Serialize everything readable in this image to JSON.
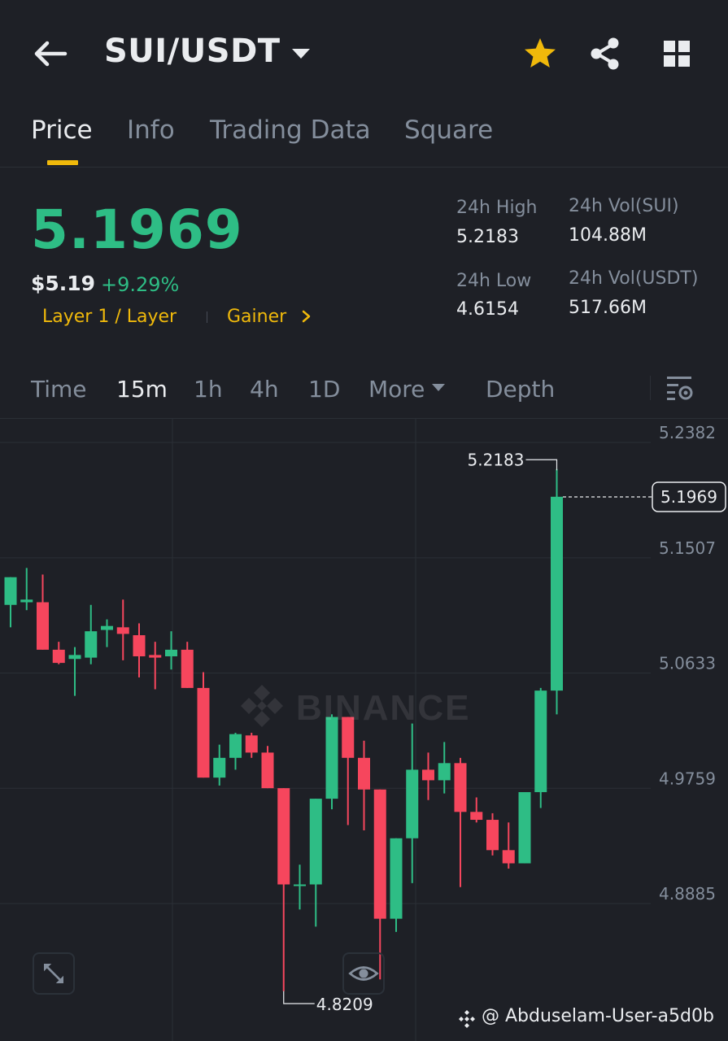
{
  "header": {
    "pair": "SUI/USDT",
    "icons": {
      "back": "arrow-left-icon",
      "caret": "caret-down-icon",
      "favorite": "star-icon",
      "share": "share-icon",
      "apps": "grid-icon"
    },
    "star_color": "#f0b90b"
  },
  "tabs": [
    {
      "label": "Price",
      "active": true
    },
    {
      "label": "Info",
      "active": false
    },
    {
      "label": "Trading Data",
      "active": false
    },
    {
      "label": "Square",
      "active": false
    }
  ],
  "price": {
    "last": "5.1969",
    "fiat": "$5.19",
    "change": "+9.29%",
    "tag_layer": "Layer 1 / Layer",
    "tag_gainer": "Gainer",
    "color_up": "#2ebd85",
    "color_down": "#f6465d",
    "accent": "#f0b90b"
  },
  "stats": {
    "high_label": "24h High",
    "high": "5.2183",
    "low_label": "24h Low",
    "low": "4.6154",
    "vol_base_label": "24h Vol(SUI)",
    "vol_base": "104.88M",
    "vol_quote_label": "24h Vol(USDT)",
    "vol_quote": "517.66M"
  },
  "timeframes": [
    {
      "label": "Time",
      "active": false
    },
    {
      "label": "15m",
      "active": true
    },
    {
      "label": "1h",
      "active": false
    },
    {
      "label": "4h",
      "active": false
    },
    {
      "label": "1D",
      "active": false
    },
    {
      "label": "More",
      "active": false
    },
    {
      "label": "Depth",
      "active": false
    }
  ],
  "chart_data": {
    "type": "candlestick",
    "interval": "15m",
    "y_ticks": [
      "5.2382",
      "5.1507",
      "5.0633",
      "4.9759",
      "4.8885"
    ],
    "ylim": [
      4.8011,
      5.2382
    ],
    "last_price": 5.1969,
    "last_price_label": "5.1969",
    "max_label": "5.2183",
    "min_label": "4.8209",
    "max_value": 5.2183,
    "min_value": 4.8209,
    "watermark": "BINANCE",
    "candles": [
      {
        "o": 5.115,
        "h": 5.126,
        "l": 5.098,
        "c": 5.136
      },
      {
        "o": 5.117,
        "h": 5.143,
        "l": 5.111,
        "c": 5.119
      },
      {
        "o": 5.117,
        "h": 5.138,
        "l": 5.085,
        "c": 5.081
      },
      {
        "o": 5.081,
        "h": 5.087,
        "l": 5.07,
        "c": 5.071
      },
      {
        "o": 5.074,
        "h": 5.083,
        "l": 5.046,
        "c": 5.077
      },
      {
        "o": 5.075,
        "h": 5.115,
        "l": 5.07,
        "c": 5.095
      },
      {
        "o": 5.096,
        "h": 5.104,
        "l": 5.083,
        "c": 5.099
      },
      {
        "o": 5.098,
        "h": 5.119,
        "l": 5.073,
        "c": 5.093
      },
      {
        "o": 5.092,
        "h": 5.101,
        "l": 5.06,
        "c": 5.076
      },
      {
        "o": 5.077,
        "h": 5.087,
        "l": 5.051,
        "c": 5.075
      },
      {
        "o": 5.076,
        "h": 5.095,
        "l": 5.066,
        "c": 5.081
      },
      {
        "o": 5.081,
        "h": 5.087,
        "l": 5.061,
        "c": 5.052
      },
      {
        "o": 5.052,
        "h": 5.064,
        "l": 4.984,
        "c": 4.984
      },
      {
        "o": 4.984,
        "h": 5.009,
        "l": 4.978,
        "c": 4.999
      },
      {
        "o": 4.999,
        "h": 5.018,
        "l": 4.99,
        "c": 5.017
      },
      {
        "o": 5.016,
        "h": 5.018,
        "l": 4.999,
        "c": 5.003
      },
      {
        "o": 5.003,
        "h": 5.008,
        "l": 4.977,
        "c": 4.976
      },
      {
        "o": 4.976,
        "h": 4.976,
        "l": 4.822,
        "c": 4.903
      },
      {
        "o": 4.903,
        "h": 4.918,
        "l": 4.884,
        "c": 4.903
      },
      {
        "o": 4.903,
        "h": 4.959,
        "l": 4.871,
        "c": 4.968
      },
      {
        "o": 4.968,
        "h": 5.032,
        "l": 4.96,
        "c": 5.03
      },
      {
        "o": 5.03,
        "h": 5.03,
        "l": 4.948,
        "c": 4.999
      },
      {
        "o": 4.999,
        "h": 5.012,
        "l": 4.944,
        "c": 4.975
      },
      {
        "o": 4.975,
        "h": 4.974,
        "l": 4.831,
        "c": 4.877
      },
      {
        "o": 4.877,
        "h": 4.927,
        "l": 4.867,
        "c": 4.938
      },
      {
        "o": 4.938,
        "h": 5.025,
        "l": 4.904,
        "c": 4.99
      },
      {
        "o": 4.99,
        "h": 5.003,
        "l": 4.967,
        "c": 4.982
      },
      {
        "o": 4.982,
        "h": 5.011,
        "l": 4.972,
        "c": 4.995
      },
      {
        "o": 4.995,
        "h": 4.999,
        "l": 4.901,
        "c": 4.958
      },
      {
        "o": 4.958,
        "h": 4.969,
        "l": 4.95,
        "c": 4.952
      },
      {
        "o": 4.952,
        "h": 4.957,
        "l": 4.925,
        "c": 4.929
      },
      {
        "o": 4.929,
        "h": 4.95,
        "l": 4.915,
        "c": 4.919
      },
      {
        "o": 4.919,
        "h": 4.971,
        "l": 4.92,
        "c": 4.973
      },
      {
        "o": 4.973,
        "h": 5.052,
        "l": 4.961,
        "c": 5.05
      },
      {
        "o": 5.05,
        "h": 5.218,
        "l": 5.032,
        "c": 5.197
      }
    ]
  },
  "controls": {
    "expand_icon": "expand-icon",
    "visibility_icon": "eye-icon"
  },
  "credit": {
    "logo_icon": "binance-logo-icon",
    "text": "@ Abduselam-User-a5d0b"
  }
}
